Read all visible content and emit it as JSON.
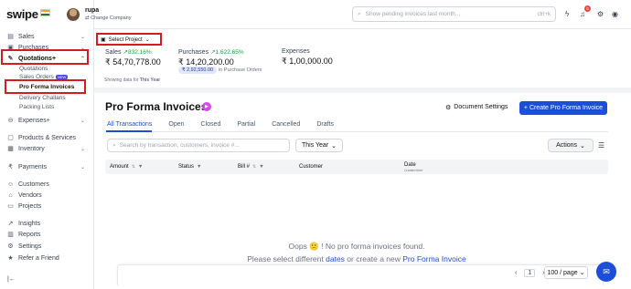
{
  "brand": {
    "name": "swipe"
  },
  "sidebar": {
    "sales": "Sales",
    "purchases": "Purchases",
    "quotations": "Quotations+",
    "sub_quotations": "Quotations",
    "sub_sales_orders": "Sales Orders",
    "sub_sales_orders_badge": "NEW",
    "sub_pro_forma": "Pro Forma Invoices",
    "sub_delivery": "Delivery Challans",
    "sub_packing": "Packing Lists",
    "expenses": "Expenses+",
    "products": "Products & Services",
    "inventory": "Inventory",
    "payments": "Payments",
    "customers": "Customers",
    "vendors": "Vendors",
    "projects": "Projects",
    "insights": "Insights",
    "reports": "Reports",
    "settings": "Settings",
    "refer": "Refer a Friend",
    "collapse": "|←"
  },
  "topbar": {
    "user_name": "rupa",
    "change_company": "Change Company",
    "search_placeholder": "Show pending invoices last month...",
    "search_shortcut": "ctrl+k",
    "notification_count": "6"
  },
  "summary": {
    "project_select": "Select Project",
    "sales_label": "Sales",
    "sales_change": "832.16%",
    "sales_value": "₹ 54,70,778.00",
    "purchases_label": "Purchases",
    "purchases_change": "1,622.65%",
    "purchases_value": "₹ 14,20,200.00",
    "purchase_orders_amount": "₹ 2,92,550.00",
    "purchase_orders_note": "in Purchase Orders",
    "expenses_label": "Expenses",
    "expenses_value": "₹ 1,00,000.00",
    "showing_prefix": "Showing data for",
    "showing_period": "This Year"
  },
  "page": {
    "title": "Pro Forma Invoices",
    "doc_settings": "Document Settings",
    "create_button": "+ Create Pro Forma Invoice",
    "tabs": [
      "All Transactions",
      "Open",
      "Closed",
      "Partial",
      "Cancelled",
      "Drafts"
    ],
    "search_placeholder": "Search by transaction, customers, invoice #...",
    "year_filter": "This Year",
    "actions": "Actions",
    "columns": {
      "amount": "Amount",
      "status": "Status",
      "bill": "Bill #",
      "customer": "Customer",
      "date": "Date",
      "date_sub": "Created time"
    },
    "empty_line1": "Oops 🙁 ! No pro forma invoices found.",
    "empty_line2_a": "Please select different",
    "empty_line2_link1": "dates",
    "empty_line2_b": "or create a new",
    "empty_line2_link2": "Pro Forma Invoice",
    "page_current": "1",
    "page_size": "100 / page"
  }
}
